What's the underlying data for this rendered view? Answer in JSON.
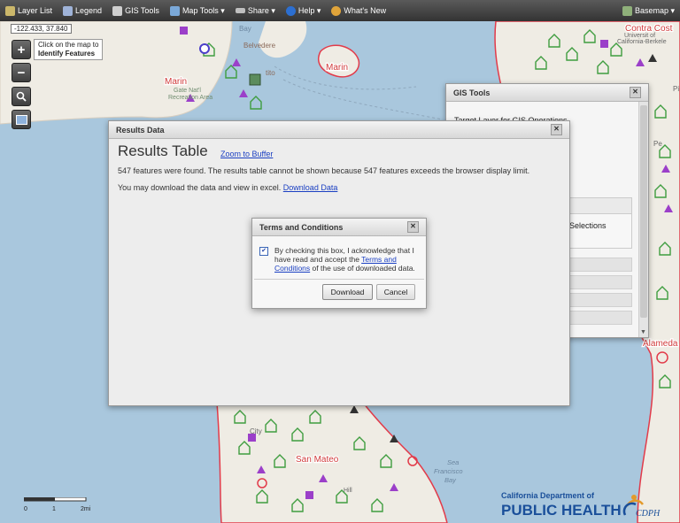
{
  "toolbar": {
    "items": [
      {
        "label": "Layer List"
      },
      {
        "label": "Legend"
      },
      {
        "label": "GIS Tools"
      },
      {
        "label": "Map Tools ▾"
      },
      {
        "label": "Share ▾"
      },
      {
        "label": "Help ▾"
      },
      {
        "label": "What's New"
      }
    ],
    "basemap_label": "Basemap ▾"
  },
  "map": {
    "coords": "-122.433, 37.840",
    "tooltip_line1": "Click on the map to",
    "tooltip_line2": "Identify Features",
    "place_labels": [
      "Marin",
      "Marin",
      "San Mateo",
      "Contra Cost",
      "Alameda",
      "Bay",
      "Belvedere",
      "tito",
      "Gate Nat'l",
      "Recreation Area",
      "Sea",
      "Francisco",
      "Bay",
      "City",
      "Hill",
      "Pi",
      "Pe",
      "Universit of",
      "California-Berkele"
    ],
    "scale_labels": [
      "0",
      "1",
      "2mi"
    ]
  },
  "gis_tools": {
    "title": "GIS Tools",
    "target_text": "Target Layer for GIS Operations",
    "selections_text": "Selections"
  },
  "results": {
    "panel_title": "Results Data",
    "title": "Results Table",
    "zoom_link": "Zoom to Buffer",
    "found_text": "547 features were found. The results table cannot be shown because 547 features exceeds the browser display limit.",
    "download_prefix": "You may download the data and view in excel. ",
    "download_link": "Download Data"
  },
  "terms": {
    "title": "Terms and Conditions",
    "text_before": "By checking this box, I acknowledge that I have read and accept the ",
    "link_text": "Terms and Conditions",
    "text_after": " of the use of downloaded data.",
    "checked": true,
    "download_label": "Download",
    "cancel_label": "Cancel"
  },
  "logo": {
    "line1": "California Department of",
    "line2": "PUBLIC HEALTH",
    "mark": "CDPH"
  },
  "colors": {
    "facility_green": "#3f9d3f",
    "facility_purple": "#9b3fc9",
    "county_red": "#e23b4a",
    "water": "#a9c7dd",
    "land": "#efece4",
    "link_blue": "#1a3fc2"
  }
}
